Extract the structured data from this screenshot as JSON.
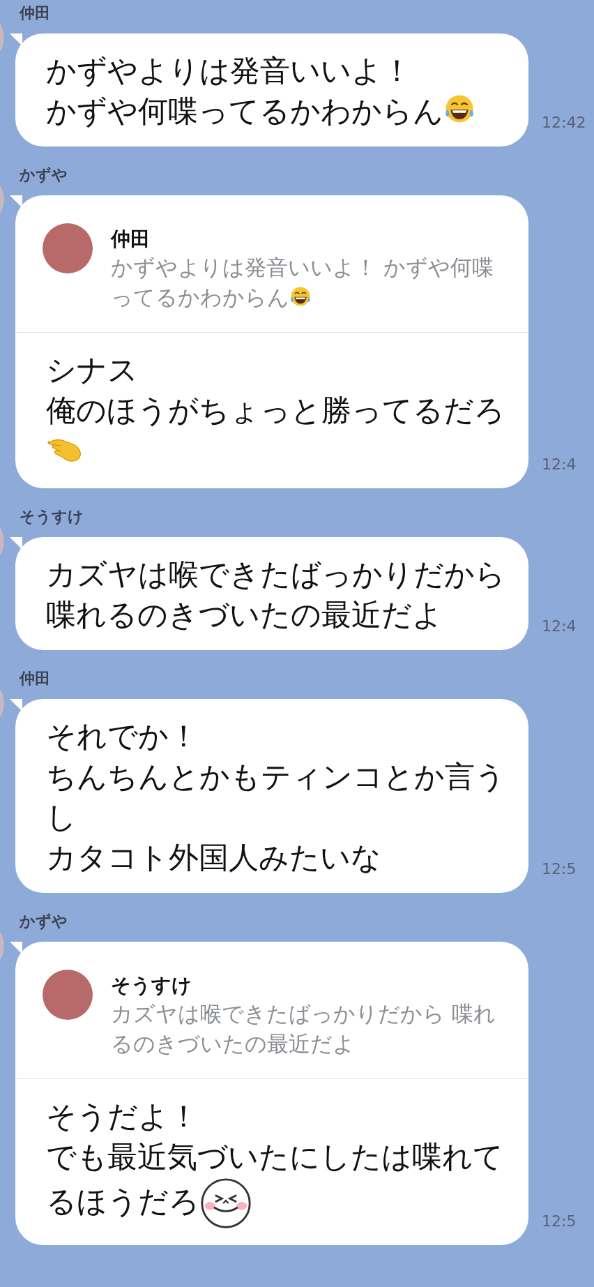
{
  "messages": [
    {
      "sender": "仲田",
      "lines": [
        "かずやよりは発音いいよ！",
        "かずや何喋ってるかわからん"
      ],
      "emoji": {
        "kind": "laughing"
      },
      "time": "12:42"
    },
    {
      "sender": "かずや",
      "reply": {
        "sender": "仲田",
        "lines": [
          "かずやよりは発音いいよ！ かずや何喋",
          "ってるかわからん"
        ],
        "emoji": {
          "kind": "laughing"
        }
      },
      "lines": [
        "シナス",
        "俺のほうがちょっと勝ってるだろ"
      ],
      "emoji": {
        "kind": "pinching"
      },
      "time": "12:4"
    },
    {
      "sender": "そうすけ",
      "lines": [
        "カズヤは喉できたばっかりだから",
        "喋れるのきづいたの最近だよ"
      ],
      "time": "12:4"
    },
    {
      "sender": "仲田",
      "lines": [
        "それでか！",
        "ちんちんとかもティンコとか言うし",
        "カタコト外国人みたいな"
      ],
      "time": "12:5"
    },
    {
      "sender": "かずや",
      "reply": {
        "sender": "そうすけ",
        "lines": [
          "カズヤは喉できたばっかりだから 喋れ",
          "るのきづいたの最近だよ"
        ]
      },
      "lines": [
        "そうだよ！",
        "でも最近気づいたにしたは喋れて",
        "るほうだろ"
      ],
      "emoji": {
        "kind": "squinting"
      },
      "time": "12:5"
    }
  ]
}
